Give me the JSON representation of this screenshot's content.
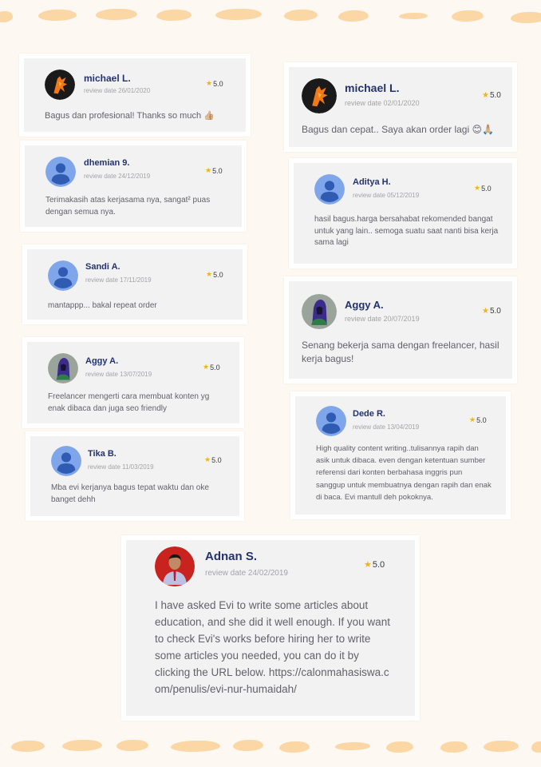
{
  "reviews": [
    {
      "name": "michael L.",
      "date": "review date 26/01/2020",
      "rating": "5.0",
      "text": "Bagus dan profesional! Thanks so much",
      "emoji": "👍🏼",
      "avatar": "dragon-logo"
    },
    {
      "name": "michael L.",
      "date": "review date 02/01/2020",
      "rating": "5.0",
      "text": "Bagus dan cepat.. Saya akan order lagi",
      "emoji": "😊🙏🏼",
      "avatar": "dragon-logo"
    },
    {
      "name": "dhemian 9.",
      "date": "review date 24/12/2019",
      "rating": "5.0",
      "text": "Terimakasih atas kerjasama nya, sangat² puas dengan semua nya.",
      "avatar": "default-user"
    },
    {
      "name": "Aditya H.",
      "date": "review date 05/12/2019",
      "rating": "5.0",
      "text": "hasil bagus.harga bersahabat rekomended bangat untuk yang lain.. semoga suatu saat nanti bisa kerja sama lagi",
      "avatar": "default-user"
    },
    {
      "name": "Sandi A.",
      "date": "review date 17/11/2019",
      "rating": "5.0",
      "text": "mantappp... bakal repeat order",
      "avatar": "default-user"
    },
    {
      "name": "Aggy A.",
      "date": "review date 20/07/2019",
      "rating": "5.0",
      "text": "Senang bekerja sama dengan freelancer, hasil kerja bagus!",
      "avatar": "hooded-figure"
    },
    {
      "name": "Aggy A.",
      "date": "review date 13/07/2019",
      "rating": "5.0",
      "text": "Freelancer mengerti cara membuat konten yg enak dibaca dan juga seo friendly",
      "avatar": "hooded-figure"
    },
    {
      "name": "Dede R.",
      "date": "review date 13/04/2019",
      "rating": "5.0",
      "text": "High quality content writing..tulisannya rapih dan asik untuk dibaca. even dengan ketentuan sumber referensi dari konten berbahasa inggris pun sanggup untuk membuatnya dengan rapih dan enak di baca. Evi mantull deh pokoknya.",
      "avatar": "default-user"
    },
    {
      "name": "Tika B.",
      "date": "review date 11/03/2019",
      "rating": "5.0",
      "text": "Mba evi kerjanya bagus tepat waktu dan oke banget dehh",
      "avatar": "default-user"
    },
    {
      "name": "Adnan S.",
      "date": "review date 24/02/2019",
      "rating": "5.0",
      "text": "I have asked Evi to write some articles about education, and she did it well enough. If you want to check Evi's works before hiring her to write some articles you needed, you can do it by clicking the URL below.",
      "url": "https://calonmahasiswa.com/penulis/evi-nur-humaidah/",
      "avatar": "photo-person"
    }
  ],
  "colors": {
    "background": "#fdf8f1",
    "card": "#f2f2f3",
    "name": "#24336e",
    "star": "#f3b21c",
    "dash": "#fcd7a6",
    "avatar_default": "#7fa6ea"
  }
}
